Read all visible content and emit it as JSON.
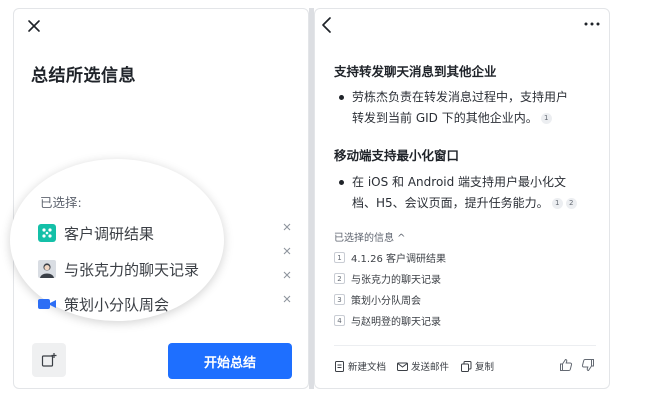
{
  "left_panel": {
    "title": "总结所选信息",
    "selected_label": "已选择:",
    "items": [
      {
        "label": "客户调研结果",
        "icon": "doc-app-icon"
      },
      {
        "label": "与张克力的聊天记录",
        "icon": "user-avatar"
      },
      {
        "label": "策划小分队周会",
        "icon": "video-meeting-icon"
      }
    ],
    "start_button": "开始总结"
  },
  "right_panel": {
    "sections": [
      {
        "heading": "支持转发聊天消息到其他企业",
        "lines": [
          "劳栋杰负责在转发消息过程中，支持用户",
          "转发到当前 GID 下的其他企业内。"
        ],
        "cites": [
          "1"
        ]
      },
      {
        "heading": "移动端支持最小化窗口",
        "lines": [
          "在 iOS 和 Android 端支持用户最小化文",
          "档、H5、会议页面，提升任务能力。"
        ],
        "cites": [
          "1",
          "2"
        ]
      }
    ],
    "sources_title": "已选择的信息 ^",
    "sources": [
      {
        "num": "1",
        "label": "4.1.26 客户调研结果"
      },
      {
        "num": "2",
        "label": "与张克力的聊天记录"
      },
      {
        "num": "3",
        "label": "策划小分队周会"
      },
      {
        "num": "4",
        "label": "与赵明登的聊天记录"
      }
    ],
    "actions": {
      "new_doc": "新建文档",
      "send_mail": "发送邮件",
      "copy": "复制"
    }
  },
  "colors": {
    "accent": "#1e6fff",
    "doc_icon": "#14c0a8",
    "video_icon": "#2d6ef5"
  }
}
